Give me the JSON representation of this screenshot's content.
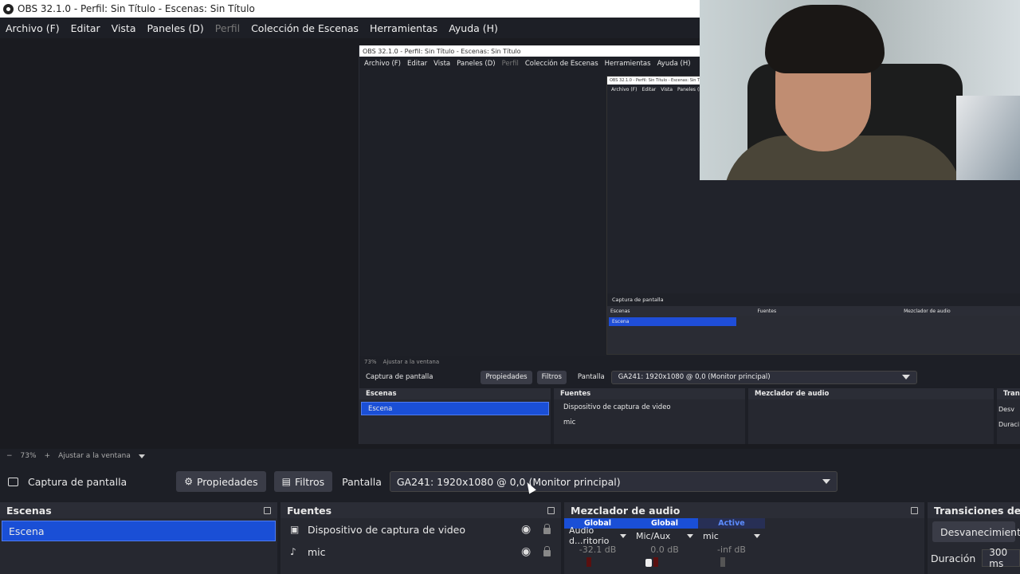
{
  "window": {
    "title": "OBS 32.1.0 - Perfil: Sin Título - Escenas: Sin Título"
  },
  "menu": {
    "items": [
      {
        "label": "Archivo (F)",
        "disabled": false
      },
      {
        "label": "Editar",
        "disabled": false
      },
      {
        "label": "Vista",
        "disabled": false
      },
      {
        "label": "Paneles (D)",
        "disabled": false
      },
      {
        "label": "Perfil",
        "disabled": true
      },
      {
        "label": "Colección de Escenas",
        "disabled": false
      },
      {
        "label": "Herramientas",
        "disabled": false
      },
      {
        "label": "Ayuda (H)",
        "disabled": false
      }
    ]
  },
  "nested": {
    "title": "OBS 32.1.0 - Perfil: Sin Título - Escenas: Sin Título",
    "status": {
      "zoom": "73%",
      "fit": "Ajustar a la ventana"
    },
    "source_label": "Captura de pantalla",
    "properties": "Propiedades",
    "filters": "Filtros",
    "screen_label": "Pantalla",
    "screen_value": "GA241: 1920x1080 @ 0,0 (Monitor principal)",
    "scenes_title": "Escenas",
    "scene": "Escena",
    "sources_title": "Fuentes",
    "sources": [
      "Dispositivo de captura de video",
      "mic"
    ],
    "mixer_title": "Mezclador de audio",
    "transitions_title": "Trans",
    "transition_value": "Desv",
    "duration_label": "Duraci"
  },
  "deep": {
    "menu": [
      "Archivo (F)",
      "Editar",
      "Vista",
      "Paneles (D)"
    ],
    "source_label": "Captura de pantalla",
    "scene": "Escena",
    "scenes_title": "Escenas",
    "sources_title": "Fuentes",
    "mixer_title": "Mezclador de audio"
  },
  "status": {
    "minus": "−",
    "zoom": "73%",
    "plus": "+",
    "fit": "Ajustar a la ventana"
  },
  "source_toolbar": {
    "source": "Captura de pantalla",
    "properties": "Propiedades",
    "filters": "Filtros",
    "screen_label": "Pantalla",
    "screen_value": "GA241: 1920x1080 @ 0,0 (Monitor principal)"
  },
  "scenes": {
    "title": "Escenas",
    "items": [
      "Escena"
    ]
  },
  "sources": {
    "title": "Fuentes",
    "items": [
      {
        "label": "Dispositivo de captura de video",
        "icon": "camera-icon"
      },
      {
        "label": "mic",
        "icon": "microphone-icon"
      }
    ]
  },
  "mixer": {
    "title": "Mezclador de audio",
    "channels": [
      {
        "tag": "Global",
        "name": "Audio d...ritorio",
        "db": "-32.1 dB",
        "tag_active": false
      },
      {
        "tag": "Global",
        "name": "Mic/Aux",
        "db": "0.0 dB",
        "tag_active": false
      },
      {
        "tag": "Active",
        "name": "mic",
        "db": "-inf dB",
        "tag_active": true
      }
    ]
  },
  "transitions": {
    "title": "Transiciones de es",
    "value": "Desvanecimiento",
    "duration_label": "Duración",
    "duration_value": "300 ms"
  },
  "colors": {
    "accent": "#1a4fd6",
    "bg": "#1d1f26",
    "panel": "#262830"
  }
}
